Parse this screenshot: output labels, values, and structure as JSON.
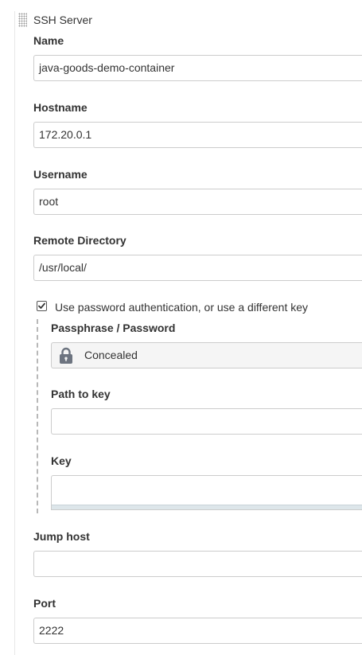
{
  "section": {
    "title": "SSH Server"
  },
  "fields": {
    "name": {
      "label": "Name",
      "value": "java-goods-demo-container"
    },
    "hostname": {
      "label": "Hostname",
      "value": "172.20.0.1"
    },
    "username": {
      "label": "Username",
      "value": "root"
    },
    "remote_directory": {
      "label": "Remote Directory",
      "value": "/usr/local/"
    },
    "use_password_auth": {
      "label": "Use password authentication, or use a different key",
      "checked": true
    },
    "passphrase": {
      "label": "Passphrase / Password",
      "value": "Concealed"
    },
    "path_to_key": {
      "label": "Path to key",
      "value": ""
    },
    "key": {
      "label": "Key",
      "value": ""
    },
    "jump_host": {
      "label": "Jump host",
      "value": ""
    },
    "port": {
      "label": "Port",
      "value": "2222"
    }
  },
  "icons": {
    "drag_handle": "grip-dots-icon",
    "passphrase": "lock-icon",
    "checkbox": "checkmark-icon"
  },
  "colors": {
    "field_border": "#cccccc",
    "concealed_background": "#f5f5f5",
    "lock_icon": "#6d7480",
    "dashed_guide": "#b8b8b8"
  }
}
